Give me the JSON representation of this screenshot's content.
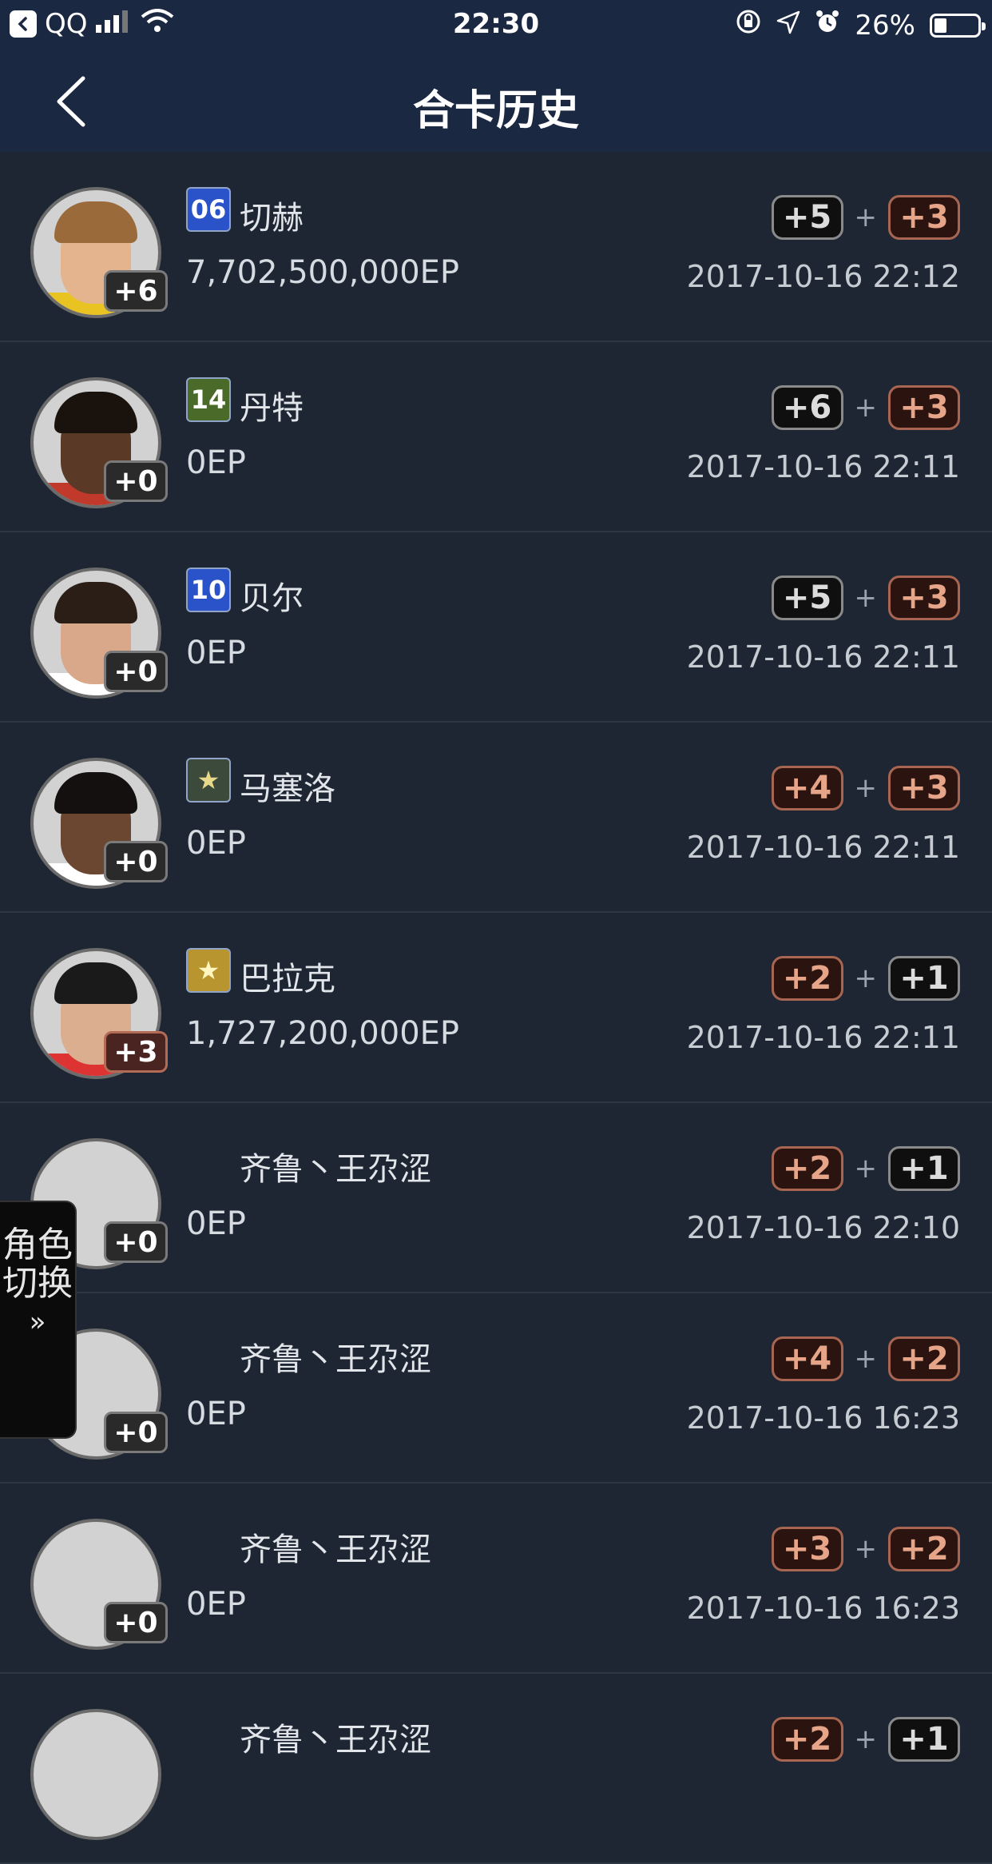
{
  "status_bar": {
    "back_app": "QQ",
    "time": "22:30",
    "battery": "26%",
    "battery_level": 0.26
  },
  "nav": {
    "title": "合卡历史"
  },
  "rows": [
    {
      "season": "06",
      "season_color": "#2b53c9",
      "name": "切赫",
      "ep": "7,702,500,000EP",
      "level": "+6",
      "level_style": "black",
      "up_a": "+5",
      "up_a_style": "black",
      "up_b": "+3",
      "up_b_style": "bronze",
      "date": "2017-10-16 22:12"
    },
    {
      "season": "14",
      "season_color": "#4a6a2a",
      "name": "丹特",
      "ep": "0EP",
      "level": "+0",
      "level_style": "black",
      "up_a": "+6",
      "up_a_style": "black",
      "up_b": "+3",
      "up_b_style": "bronze",
      "date": "2017-10-16 22:11"
    },
    {
      "season": "10",
      "season_color": "#2b53c9",
      "name": "贝尔",
      "ep": "0EP",
      "level": "+0",
      "level_style": "black",
      "up_a": "+5",
      "up_a_style": "black",
      "up_b": "+3",
      "up_b_style": "bronze",
      "date": "2017-10-16 22:11"
    },
    {
      "season": "★",
      "season_color": "#3b4a3a",
      "name": "马塞洛",
      "ep": "0EP",
      "level": "+0",
      "level_style": "black",
      "up_a": "+4",
      "up_a_style": "bronze",
      "up_b": "+3",
      "up_b_style": "bronze",
      "date": "2017-10-16 22:11"
    },
    {
      "season": "★",
      "season_color": "#b8952e",
      "name": "巴拉克",
      "ep": "1,727,200,000EP",
      "level": "+3",
      "level_style": "bronze",
      "up_a": "+2",
      "up_a_style": "bronze",
      "up_b": "+1",
      "up_b_style": "black",
      "date": "2017-10-16 22:11"
    },
    {
      "season": "",
      "season_color": "",
      "name": "齐鲁丶王尕涩",
      "ep": "0EP",
      "level": "+0",
      "level_style": "black",
      "up_a": "+2",
      "up_a_style": "bronze",
      "up_b": "+1",
      "up_b_style": "black",
      "date": "2017-10-16 22:10"
    },
    {
      "season": "",
      "season_color": "",
      "name": "齐鲁丶王尕涩",
      "ep": "0EP",
      "level": "+0",
      "level_style": "black",
      "up_a": "+4",
      "up_a_style": "bronze",
      "up_b": "+2",
      "up_b_style": "bronze",
      "date": "2017-10-16 16:23"
    },
    {
      "season": "",
      "season_color": "",
      "name": "齐鲁丶王尕涩",
      "ep": "0EP",
      "level": "+0",
      "level_style": "black",
      "up_a": "+3",
      "up_a_style": "bronze",
      "up_b": "+2",
      "up_b_style": "bronze",
      "date": "2017-10-16 16:23"
    },
    {
      "season": "",
      "season_color": "",
      "name": "齐鲁丶王尕涩",
      "ep": "",
      "level": "",
      "level_style": "black",
      "up_a": "+2",
      "up_a_style": "bronze",
      "up_b": "+1",
      "up_b_style": "black",
      "date": ""
    }
  ],
  "side_tab": {
    "label": "角色切换",
    "arrow": "»"
  }
}
